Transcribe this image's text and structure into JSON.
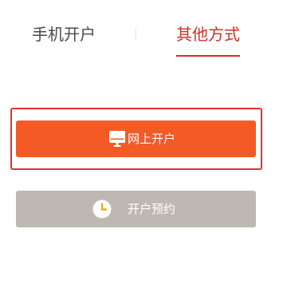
{
  "tabs": [
    {
      "label": "手机开户",
      "active": false
    },
    {
      "label": "其他方式",
      "active": true
    }
  ],
  "buttons": {
    "online_open": {
      "label": "网上开户",
      "icon": "monitor-icon",
      "color": "#f35a25"
    },
    "appointment": {
      "label": "开户预约",
      "icon": "clock-icon",
      "color": "#bdb8b2"
    }
  },
  "colors": {
    "active_tab": "#c8322a",
    "inactive_tab": "#4a4a4a",
    "highlight_border": "#e23030"
  }
}
